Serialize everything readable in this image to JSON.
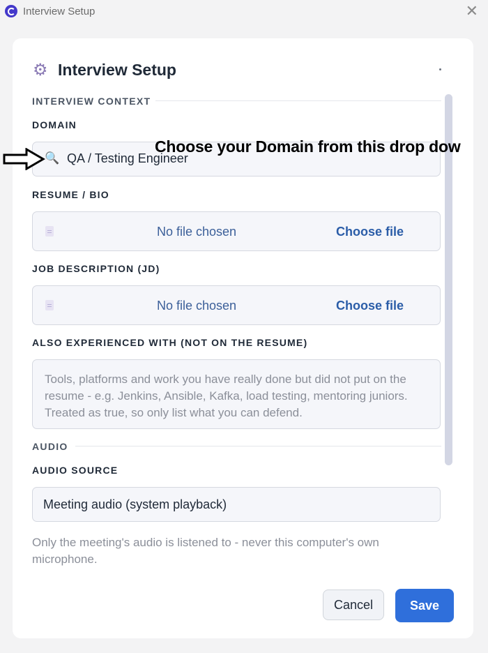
{
  "window": {
    "title": "Interview Setup",
    "close_glyph": "✕"
  },
  "header": {
    "icon": "gear-icon",
    "icon_glyph": "⚙",
    "title": "Interview Setup"
  },
  "sections": {
    "context": "INTERVIEW CONTEXT",
    "audio": "AUDIO"
  },
  "domain": {
    "label": "DOMAIN",
    "icon": "search-icon",
    "value": "QA / Testing Engineer"
  },
  "resume": {
    "label": "RESUME / BIO",
    "status": "No file chosen",
    "button": "Choose file"
  },
  "jd": {
    "label": "JOB DESCRIPTION (JD)",
    "status": "No file chosen",
    "button": "Choose file"
  },
  "experience": {
    "label": "ALSO EXPERIENCED WITH (NOT ON THE RESUME)",
    "placeholder": "Tools, platforms and work you have really done but did not put on the resume - e.g. Jenkins, Ansible, Kafka, load testing, mentoring juniors. Treated as true, so only list what you can defend."
  },
  "audio_source": {
    "label": "AUDIO SOURCE",
    "value": "Meeting audio (system playback)",
    "help": "Only the meeting's audio is listened to - never this computer's own microphone."
  },
  "actions": {
    "cancel": "Cancel",
    "save": "Save"
  },
  "annotation": {
    "text": "Choose your Domain from this drop dow"
  },
  "colors": {
    "accent": "#2f6fdb",
    "link": "#2b5da8"
  }
}
